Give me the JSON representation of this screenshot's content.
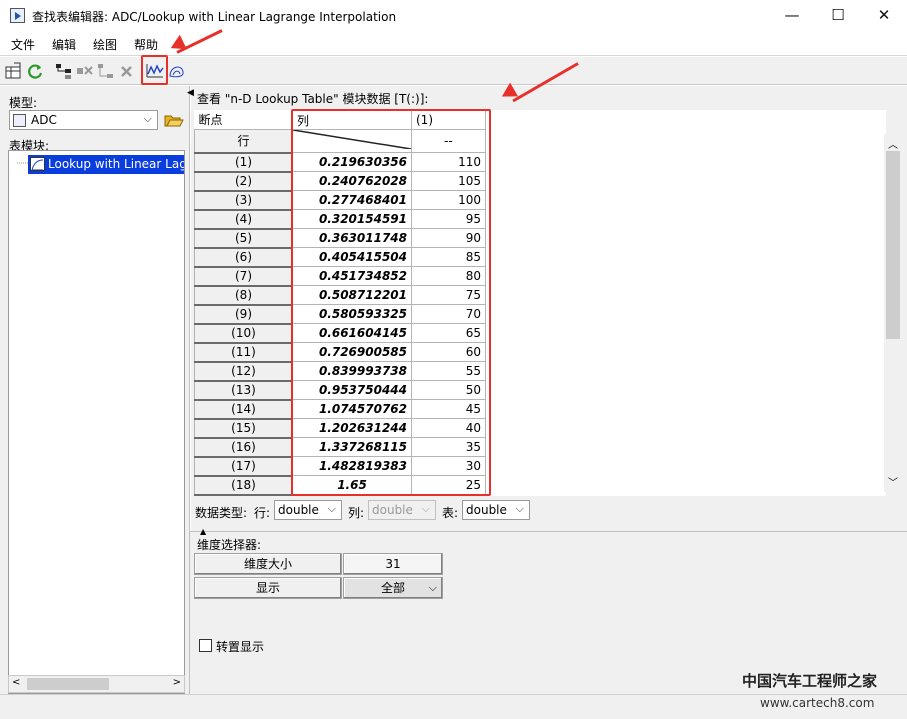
{
  "window": {
    "title": "查找表编辑器: ADC/Lookup with Linear Lagrange Interpolation",
    "minimize": "—",
    "maximize": "☐",
    "close": "✕"
  },
  "menu": [
    "文件",
    "编辑",
    "绘图",
    "帮助"
  ],
  "toolbar_icons": [
    "table-open-icon",
    "refresh-icon",
    "tree-link-icon",
    "tree-delete-icon",
    "tree-add-icon",
    "remove-icon",
    "line-plot-icon",
    "mesh-plot-icon"
  ],
  "left": {
    "model_label": "模型:",
    "model_value": "ADC",
    "table_block_label": "表模块:",
    "tree_item": "Lookup with Linear Lagrange Interpolation"
  },
  "table": {
    "heading": "查看 \"n-D Lookup Table\" 模块数据 [T(:)]:",
    "breakpoint_header": "断点",
    "col_header": "列",
    "col_index": "(1)",
    "row_label": "行",
    "col_dash": "--",
    "rows": [
      {
        "idx": "(1)",
        "bp": "0.219630356",
        "val": "110"
      },
      {
        "idx": "(2)",
        "bp": "0.240762028",
        "val": "105"
      },
      {
        "idx": "(3)",
        "bp": "0.277468401",
        "val": "100"
      },
      {
        "idx": "(4)",
        "bp": "0.320154591",
        "val": "95"
      },
      {
        "idx": "(5)",
        "bp": "0.363011748",
        "val": "90"
      },
      {
        "idx": "(6)",
        "bp": "0.405415504",
        "val": "85"
      },
      {
        "idx": "(7)",
        "bp": "0.451734852",
        "val": "80"
      },
      {
        "idx": "(8)",
        "bp": "0.508712201",
        "val": "75"
      },
      {
        "idx": "(9)",
        "bp": "0.580593325",
        "val": "70"
      },
      {
        "idx": "(10)",
        "bp": "0.661604145",
        "val": "65"
      },
      {
        "idx": "(11)",
        "bp": "0.726900585",
        "val": "60"
      },
      {
        "idx": "(12)",
        "bp": "0.839993738",
        "val": "55"
      },
      {
        "idx": "(13)",
        "bp": "0.953750444",
        "val": "50"
      },
      {
        "idx": "(14)",
        "bp": "1.074570762",
        "val": "45"
      },
      {
        "idx": "(15)",
        "bp": "1.202631244",
        "val": "40"
      },
      {
        "idx": "(16)",
        "bp": "1.337268115",
        "val": "35"
      },
      {
        "idx": "(17)",
        "bp": "1.482819383",
        "val": "30"
      },
      {
        "idx": "(18)",
        "bp": "1.65",
        "val": "25"
      }
    ]
  },
  "datatype": {
    "label": "数据类型:",
    "row_label": "行:",
    "row_value": "double",
    "col_label": "列:",
    "col_value": "double",
    "table_label": "表:",
    "table_value": "double"
  },
  "dimension": {
    "label": "维度选择器:",
    "size_label": "维度大小",
    "size_value": "31",
    "show_label": "显示",
    "show_value": "全部"
  },
  "transpose_label": "转置显示",
  "watermark": {
    "top": "中国汽车工程师之家",
    "bottom": "www.cartech8.com"
  },
  "colors": {
    "highlight": "#e8302a",
    "selection": "#0a3dde"
  }
}
